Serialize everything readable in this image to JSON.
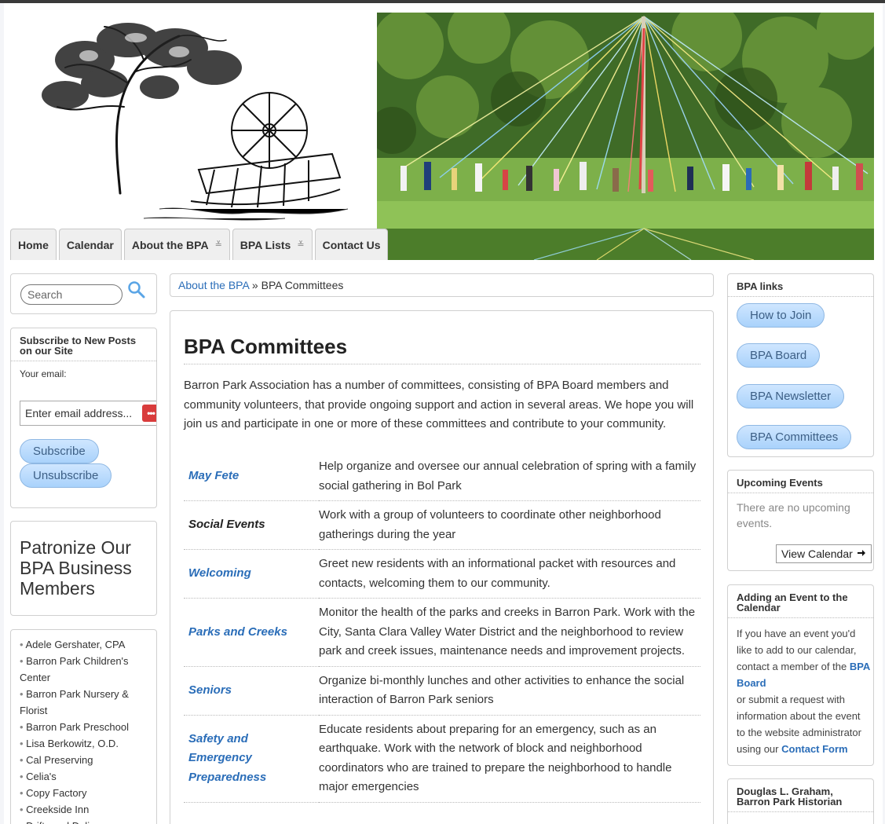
{
  "nav": {
    "items": [
      {
        "label": "Home",
        "dropdown": false
      },
      {
        "label": "Calendar",
        "dropdown": false
      },
      {
        "label": "About the BPA",
        "dropdown": true
      },
      {
        "label": "BPA Lists",
        "dropdown": true
      },
      {
        "label": "Contact Us",
        "dropdown": false
      }
    ]
  },
  "search": {
    "placeholder": "Search"
  },
  "subscribe": {
    "title": "Subscribe to New Posts on our Site",
    "email_label": "Your email:",
    "email_placeholder": "Enter email address...",
    "subscribe_label": "Subscribe",
    "unsubscribe_label": "Unsubscribe"
  },
  "patronize": {
    "title": "Patronize Our BPA Business Members"
  },
  "businesses": [
    "Adele Gershater, CPA",
    "Barron Park Children's Center",
    "Barron Park Nursery & Florist",
    "Barron Park Preschool",
    "Lisa Berkowitz, O.D.",
    "Cal Preserving",
    "Celia's",
    "Copy Factory",
    "Creekside Inn",
    "Driftwood Deli"
  ],
  "breadcrumb": {
    "parent": "About the BPA",
    "separator": "»",
    "current": "BPA Committees"
  },
  "main": {
    "title": "BPA Committees",
    "intro": "Barron Park Association has a number of committees, consisting of BPA Board members and community volunteers, that provide ongoing support and action in several areas. We hope you will join us and participate in one or more of these committees and contribute to your community.",
    "committees": [
      {
        "name": "May Fete",
        "linked": true,
        "description": "Help organize and oversee our annual celebration of spring with a family social gathering in Bol Park"
      },
      {
        "name": "Social Events",
        "linked": false,
        "description": "Work with a group of volunteers to coordinate other neighborhood gatherings during the year"
      },
      {
        "name": "Welcoming",
        "linked": true,
        "description": "Greet new residents with an informational packet with resources and contacts, welcoming them to our community."
      },
      {
        "name": "Parks and Creeks",
        "linked": true,
        "description": "Monitor the health of the parks and creeks in Barron Park. Work with the City, Santa Clara Valley Water District and the neighborhood to review park and creek issues, maintenance needs and improvement projects."
      },
      {
        "name": "Seniors",
        "linked": true,
        "description": "Organize bi-monthly lunches and other activities to enhance the social interaction of Barron Park seniors"
      },
      {
        "name": "Safety and Emergency Preparedness",
        "linked": true,
        "description": "Educate residents about preparing for an emergency, such as an earthquake. Work with the network of block and neighborhood coordinators who are trained to prepare the neighborhood to handle major emergencies"
      }
    ]
  },
  "bpa_links": {
    "title": "BPA links",
    "items": [
      "How to Join",
      "BPA Board",
      "BPA Newsletter",
      "BPA Committees"
    ]
  },
  "upcoming": {
    "title": "Upcoming Events",
    "empty_text": "There are no upcoming events.",
    "view_calendar": "View Calendar"
  },
  "adding_event": {
    "title": "Adding an Event to the Calendar",
    "text1": "If you have an event you'd like to add to our calendar, contact a member of the",
    "link1": "BPA Board",
    "text2": "or submit a request with information about the event to the website administrator using our",
    "link2": "Contact Form"
  },
  "historian": {
    "title": "Douglas L. Graham, Barron Park Historian"
  },
  "colors": {
    "link": "#2a6db8",
    "pill_bg": "#a9d2fb",
    "subscribe_icon": "#d93c3c"
  }
}
